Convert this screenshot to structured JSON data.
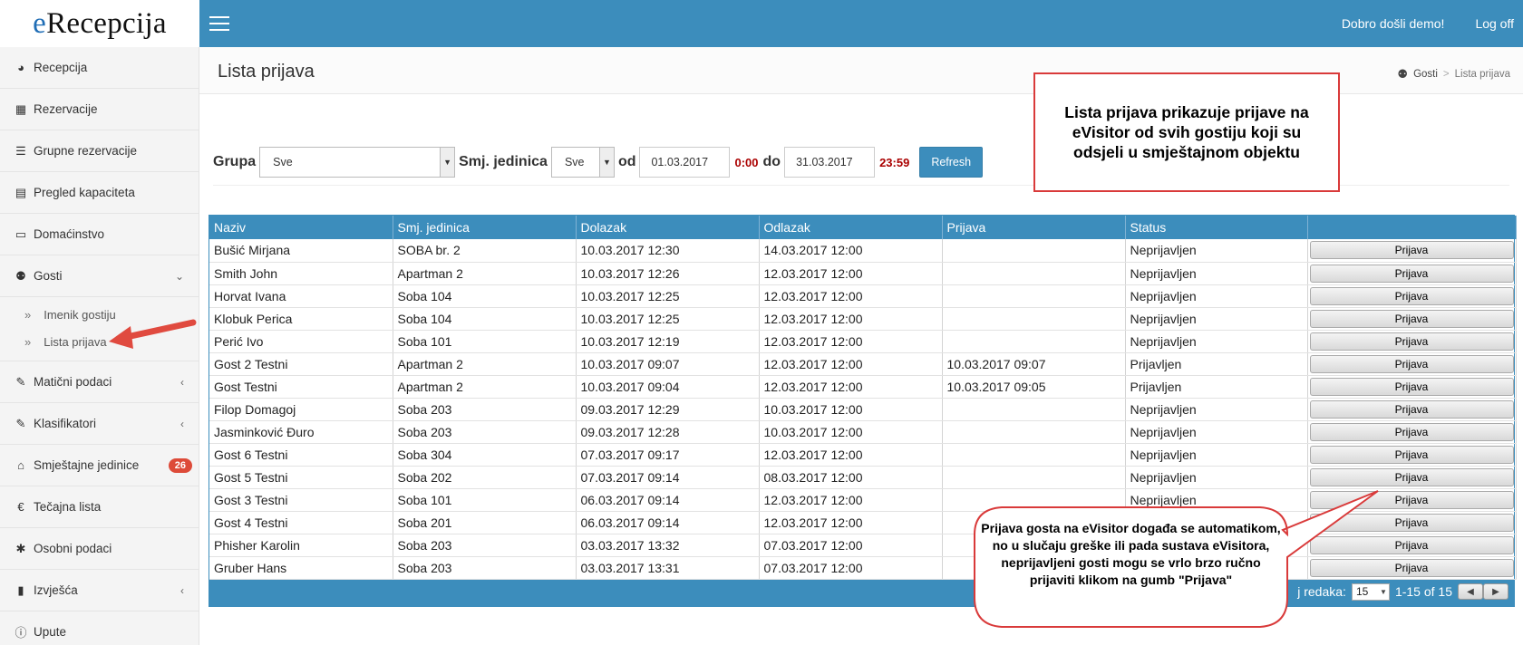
{
  "app": {
    "logo_e": "e",
    "logo_rest": "Recepcija",
    "welcome": "Dobro došli demo!",
    "logoff": "Log off"
  },
  "sidebar": {
    "items": [
      {
        "label": "Recepcija",
        "icon": "dashboard-icon",
        "glyph": "◕"
      },
      {
        "label": "Rezervacije",
        "icon": "grid-icon",
        "glyph": "▦"
      },
      {
        "label": "Grupne rezervacije",
        "icon": "list-icon",
        "glyph": "☰"
      },
      {
        "label": "Pregled kapaciteta",
        "icon": "calendar-icon",
        "glyph": "▤"
      },
      {
        "label": "Domaćinstvo",
        "icon": "card-icon",
        "glyph": "▭"
      },
      {
        "label": "Gosti",
        "icon": "users-icon",
        "glyph": "⚉",
        "arrow": "⌄"
      },
      {
        "label": "Matični podaci",
        "icon": "edit-icon",
        "glyph": "✎",
        "arrow": "‹"
      },
      {
        "label": "Klasifikatori",
        "icon": "edit-icon",
        "glyph": "✎",
        "arrow": "‹"
      },
      {
        "label": "Smještajne jedinice",
        "icon": "home-icon",
        "glyph": "⌂",
        "badge": "26"
      },
      {
        "label": "Tečajna lista",
        "icon": "euro-icon",
        "glyph": "€"
      },
      {
        "label": "Osobni podaci",
        "icon": "asterisk-icon",
        "glyph": "✱"
      },
      {
        "label": "Izvješća",
        "icon": "bar-chart-icon",
        "glyph": "▮",
        "arrow": "‹"
      },
      {
        "label": "Upute",
        "icon": "info-icon",
        "glyph": "ⓘ"
      }
    ],
    "submenu": [
      {
        "label": "Imenik gostiju",
        "glyph": "»"
      },
      {
        "label": "Lista prijava",
        "glyph": "»"
      }
    ]
  },
  "header": {
    "title": "Lista prijava",
    "breadcrumb": [
      "Gosti",
      "Lista prijava"
    ],
    "breadcrumb_sep": ">"
  },
  "filter": {
    "grupa_label": "Grupa",
    "grupa_value": "Sve",
    "smj_label": "Smj. jedinica",
    "smj_value": "Sve",
    "od_label": "od",
    "date_from": "01.03.2017",
    "time_from": "0:00",
    "do_label": "do",
    "date_to": "31.03.2017",
    "time_to": "23:59",
    "refresh": "Refresh"
  },
  "table": {
    "columns": [
      "Naziv",
      "Smj. jedinica",
      "Dolazak",
      "Odlazak",
      "Prijava",
      "Status",
      ""
    ],
    "button_label": "Prijava",
    "rows": [
      [
        "Bušić Mirjana",
        "SOBA br. 2",
        "10.03.2017 12:30",
        "14.03.2017 12:00",
        "",
        "Neprijavljen"
      ],
      [
        "Smith John",
        "Apartman 2",
        "10.03.2017 12:26",
        "12.03.2017 12:00",
        "",
        "Neprijavljen"
      ],
      [
        "Horvat Ivana",
        "Soba 104",
        "10.03.2017 12:25",
        "12.03.2017 12:00",
        "",
        "Neprijavljen"
      ],
      [
        "Klobuk Perica",
        "Soba 104",
        "10.03.2017 12:25",
        "12.03.2017 12:00",
        "",
        "Neprijavljen"
      ],
      [
        "Perić Ivo",
        "Soba 101",
        "10.03.2017 12:19",
        "12.03.2017 12:00",
        "",
        "Neprijavljen"
      ],
      [
        "Gost 2 Testni",
        "Apartman 2",
        "10.03.2017 09:07",
        "12.03.2017 12:00",
        "10.03.2017 09:07",
        "Prijavljen"
      ],
      [
        "Gost Testni",
        "Apartman 2",
        "10.03.2017 09:04",
        "12.03.2017 12:00",
        "10.03.2017 09:05",
        "Prijavljen"
      ],
      [
        "Filop Domagoj",
        "Soba 203",
        "09.03.2017 12:29",
        "10.03.2017 12:00",
        "",
        "Neprijavljen"
      ],
      [
        "Jasminković Đuro",
        "Soba 203",
        "09.03.2017 12:28",
        "10.03.2017 12:00",
        "",
        "Neprijavljen"
      ],
      [
        "Gost 6 Testni",
        "Soba 304",
        "07.03.2017 09:17",
        "12.03.2017 12:00",
        "",
        "Neprijavljen"
      ],
      [
        "Gost 5 Testni",
        "Soba 202",
        "07.03.2017 09:14",
        "08.03.2017 12:00",
        "",
        "Neprijavljen"
      ],
      [
        "Gost 3 Testni",
        "Soba 101",
        "06.03.2017 09:14",
        "12.03.2017 12:00",
        "",
        "Neprijavljen"
      ],
      [
        "Gost 4 Testni",
        "Soba 201",
        "06.03.2017 09:14",
        "12.03.2017 12:00",
        "",
        ""
      ],
      [
        "Phisher Karolin",
        "Soba 203",
        "03.03.2017 13:32",
        "07.03.2017 12:00",
        "",
        ""
      ],
      [
        "Gruber Hans",
        "Soba 203",
        "03.03.2017 13:31",
        "07.03.2017 12:00",
        "",
        ""
      ]
    ],
    "footer_rows_label": "j redaka:",
    "page_size": "15",
    "range": "1-15 of 15"
  },
  "annotations": {
    "callout_top": "Lista prijava prikazuje prijave na eVisitor od svih gostiju koji su odsjeli u smještajnom objektu",
    "callout_bottom": "Prijava gosta na eVisitor događa se automatikom, no u slučaju greške ili pada sustava eVisitora, neprijavljeni gosti mogu se vrlo brzo ručno prijaviti klikom na gumb \"Prijava\"",
    "accent_color": "#3c8dbc",
    "annotation_color": "#d93a3a"
  }
}
